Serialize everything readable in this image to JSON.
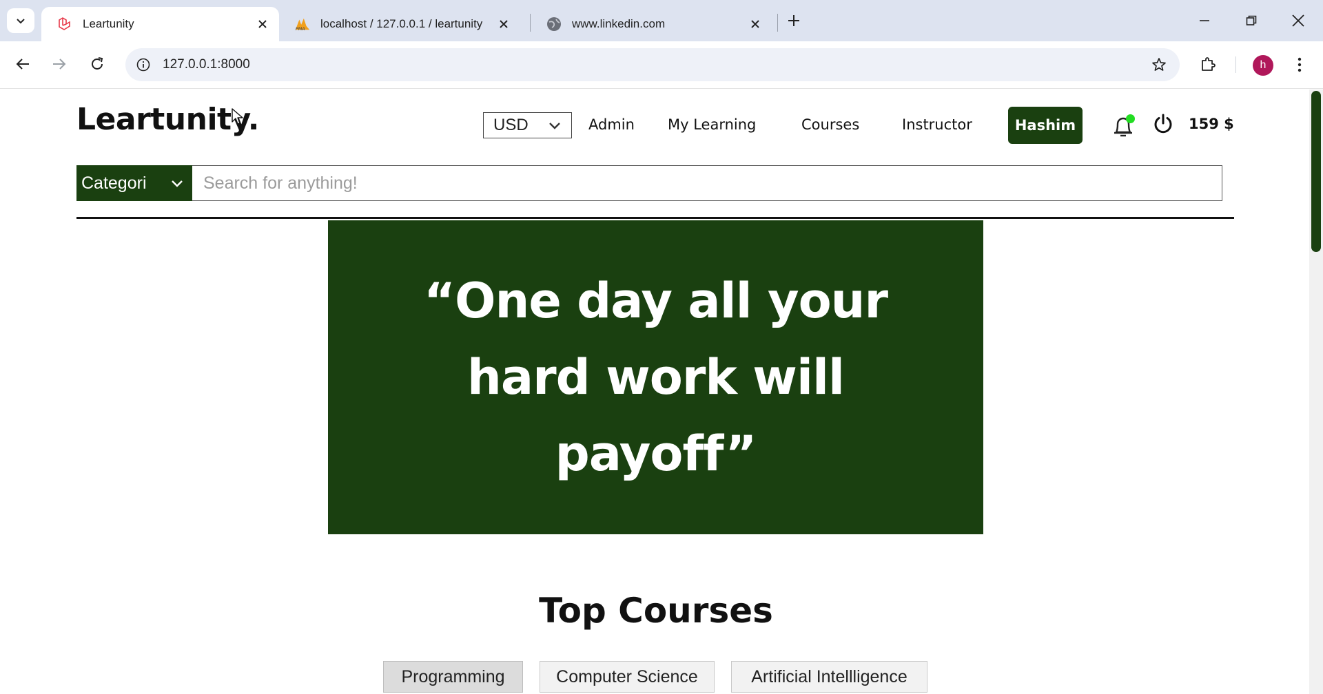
{
  "browser": {
    "tabs": [
      {
        "title": "Leartunity",
        "active": true
      },
      {
        "title": "localhost / 127.0.0.1 / leartunity",
        "active": false
      },
      {
        "title": "www.linkedin.com",
        "active": false
      }
    ],
    "url": "127.0.0.1:8000",
    "profile_initial": "h"
  },
  "header": {
    "logo": "Leartunity.",
    "currency": "USD",
    "nav": [
      "Admin",
      "My Learning",
      "Courses",
      "Instructor"
    ],
    "user_button": "Hashim",
    "balance": "159 $"
  },
  "search": {
    "category_label": "Categori",
    "placeholder": "Search for anything!"
  },
  "hero": {
    "quote": "“One day all your hard work will payoff”"
  },
  "top_courses": {
    "title": "Top Courses",
    "categories": [
      "Programming",
      "Computer Science",
      "Artificial Intellligence"
    ],
    "selected": "Programming"
  },
  "colors": {
    "brand_green": "#1a4010",
    "notification_dot": "#22dd22",
    "avatar": "#b0175a"
  }
}
